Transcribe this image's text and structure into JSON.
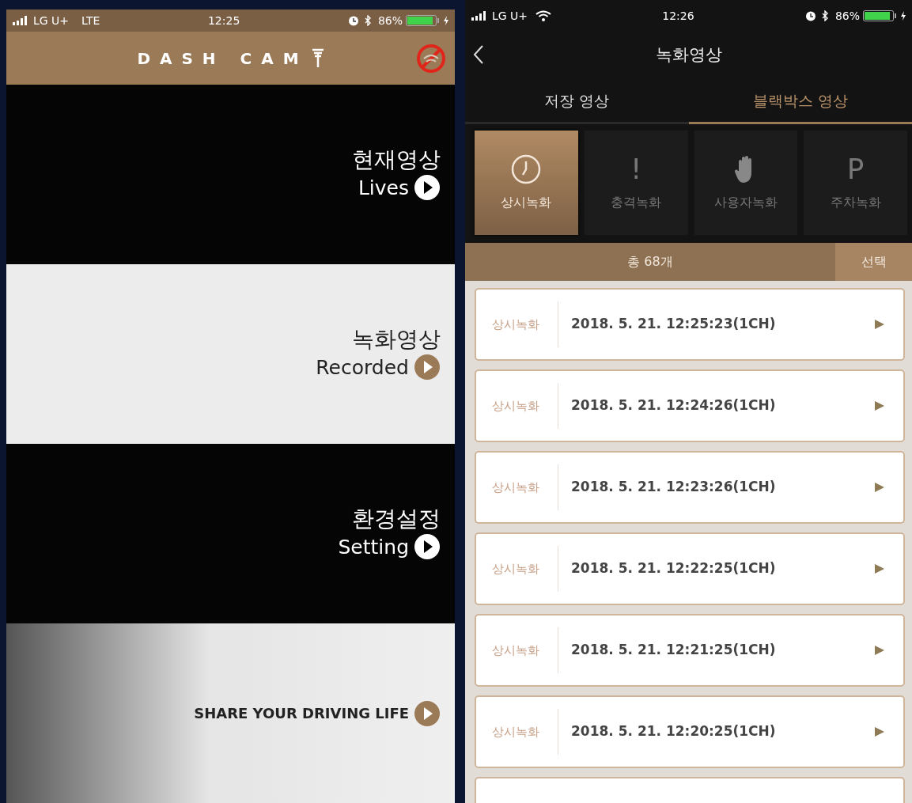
{
  "left_screen": {
    "status_bar": {
      "carrier": "LG U+",
      "network": "LTE",
      "time": "12:25",
      "battery": "86%"
    },
    "header": {
      "title": "DASH CAM",
      "wifi_blocked": true
    },
    "menu": [
      {
        "kind": "dark",
        "title": "현재영상",
        "subtitle": "Lives"
      },
      {
        "kind": "light",
        "title": "녹화영상",
        "subtitle": "Recorded"
      },
      {
        "kind": "dark",
        "title": "환경설정",
        "subtitle": "Setting"
      },
      {
        "kind": "banner",
        "subtitle": "SHARE YOUR DRIVING LIFE"
      }
    ]
  },
  "right_screen": {
    "status_bar": {
      "carrier": "LG U+",
      "wifi": true,
      "time": "12:26",
      "battery": "86%"
    },
    "header": {
      "title": "녹화영상"
    },
    "tabs": [
      {
        "label": "저장 영상",
        "selected": false
      },
      {
        "label": "블랙박스 영상",
        "selected": true
      }
    ],
    "categories": [
      {
        "kind": "clock",
        "label": "상시녹화",
        "selected": true
      },
      {
        "kind": "text",
        "glyph": "!",
        "label": "충격녹화",
        "selected": false
      },
      {
        "kind": "hand",
        "label": "사용자녹화",
        "selected": false
      },
      {
        "kind": "text",
        "glyph": "P",
        "label": "주차녹화",
        "selected": false
      }
    ],
    "count": "총 68개",
    "select_button": "선택",
    "recordings": [
      {
        "type": "상시녹화",
        "datetime": "2018. 5. 21. 12:25:23(1CH)"
      },
      {
        "type": "상시녹화",
        "datetime": "2018. 5. 21. 12:24:26(1CH)"
      },
      {
        "type": "상시녹화",
        "datetime": "2018. 5. 21. 12:23:26(1CH)"
      },
      {
        "type": "상시녹화",
        "datetime": "2018. 5. 21. 12:22:25(1CH)"
      },
      {
        "type": "상시녹화",
        "datetime": "2018. 5. 21. 12:21:25(1CH)"
      },
      {
        "type": "상시녹화",
        "datetime": "2018. 5. 21. 12:20:25(1CH)"
      }
    ]
  }
}
